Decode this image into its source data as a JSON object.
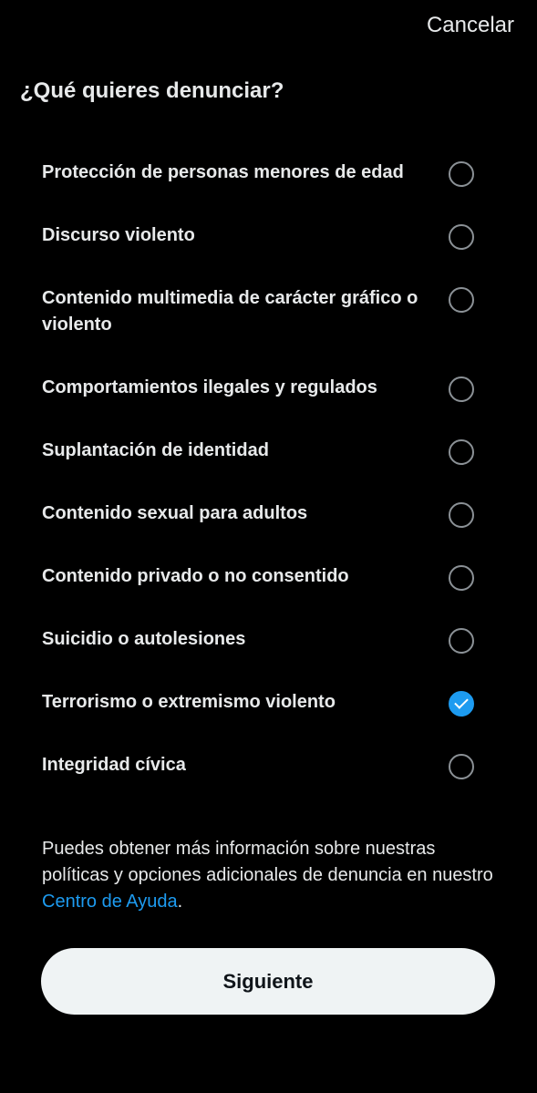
{
  "header": {
    "cancel_label": "Cancelar",
    "title": "¿Qué quieres denunciar?"
  },
  "options": [
    {
      "label": "Protección de personas menores de edad",
      "selected": false
    },
    {
      "label": "Discurso violento",
      "selected": false
    },
    {
      "label": "Contenido multimedia de carácter gráfico o violento",
      "selected": false
    },
    {
      "label": "Comportamientos ilegales y regulados",
      "selected": false
    },
    {
      "label": "Suplantación de identidad",
      "selected": false
    },
    {
      "label": "Contenido sexual para adultos",
      "selected": false
    },
    {
      "label": "Contenido privado o no consentido",
      "selected": false
    },
    {
      "label": "Suicidio o autolesiones",
      "selected": false
    },
    {
      "label": "Terrorismo o extremismo violento",
      "selected": true
    },
    {
      "label": "Integridad cívica",
      "selected": false
    }
  ],
  "help": {
    "text_before": "Puedes obtener más información sobre nuestras políticas y opciones adicionales de denuncia en nuestro ",
    "link_label": "Centro de Ayuda",
    "text_after": "."
  },
  "footer": {
    "next_label": "Siguiente"
  },
  "colors": {
    "background": "#000000",
    "text": "#e7e9ea",
    "accent": "#1d9bf0",
    "radio_border": "#8b9196",
    "button_bg": "#eff3f4",
    "button_text": "#0f1419"
  },
  "icons": {
    "selected_radio": "check-icon"
  }
}
